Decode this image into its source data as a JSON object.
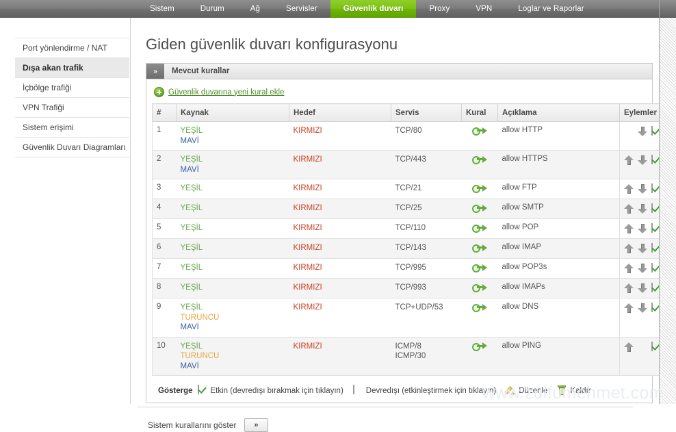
{
  "topnav": {
    "items": [
      {
        "label": "Sistem",
        "active": false
      },
      {
        "label": "Durum",
        "active": false
      },
      {
        "label": "Ağ",
        "active": false
      },
      {
        "label": "Servisler",
        "active": false
      },
      {
        "label": "Güvenlik duvarı",
        "active": true
      },
      {
        "label": "Proxy",
        "active": false
      },
      {
        "label": "VPN",
        "active": false
      },
      {
        "label": "Loglar ve Raporlar",
        "active": false
      }
    ],
    "accent_color": "#7cc114",
    "bar_color": "#7d7d7d"
  },
  "sidebar": {
    "items": [
      {
        "label": "Port yönlendirme / NAT",
        "active": false
      },
      {
        "label": "Dışa akan trafik",
        "active": true
      },
      {
        "label": "İçbölge trafiği",
        "active": false
      },
      {
        "label": "VPN Trafiği",
        "active": false
      },
      {
        "label": "Sistem erişimi",
        "active": false
      },
      {
        "label": "Güvenlik Duvarı Diagramları",
        "active": false
      }
    ]
  },
  "main": {
    "page_title": "Giden güvenlik duvarı konfigurasyonu",
    "panel": {
      "toggle_label": "»",
      "title": "Mevcut kurallar",
      "add_rule_label": "Güvenlik duvarına yeni kural ekle"
    },
    "table": {
      "headers": [
        "#",
        "Kaynak",
        "Hedef",
        "Servis",
        "Kural",
        "Açıklama",
        "Eylemler"
      ],
      "rows": [
        {
          "num": "1",
          "sources": [
            {
              "text": "YEŞİL",
              "color": "green"
            },
            {
              "text": "MAVİ",
              "color": "blue"
            }
          ],
          "dest": "KIRMIZI",
          "service": [
            "TCP/80"
          ],
          "rule_icon": "rule-flow-allow-icon",
          "description": "allow HTTP",
          "actions": [
            "spacer",
            "down",
            "check-on",
            "edit",
            "delete"
          ]
        },
        {
          "num": "2",
          "sources": [
            {
              "text": "YEŞİL",
              "color": "green"
            },
            {
              "text": "MAVİ",
              "color": "blue"
            }
          ],
          "dest": "KIRMIZI",
          "service": [
            "TCP/443"
          ],
          "rule_icon": "rule-flow-allow-icon",
          "description": "allow HTTPS",
          "actions": [
            "up",
            "down",
            "check-on",
            "edit",
            "delete"
          ]
        },
        {
          "num": "3",
          "sources": [
            {
              "text": "YEŞİL",
              "color": "green"
            }
          ],
          "dest": "KIRMIZI",
          "service": [
            "TCP/21"
          ],
          "rule_icon": "rule-flow-allow-icon",
          "description": "allow FTP",
          "actions": [
            "up",
            "down",
            "check-on",
            "edit",
            "delete"
          ]
        },
        {
          "num": "4",
          "sources": [
            {
              "text": "YEŞİL",
              "color": "green"
            }
          ],
          "dest": "KIRMIZI",
          "service": [
            "TCP/25"
          ],
          "rule_icon": "rule-flow-allow-icon",
          "description": "allow SMTP",
          "actions": [
            "up",
            "down",
            "check-on",
            "edit",
            "delete"
          ]
        },
        {
          "num": "5",
          "sources": [
            {
              "text": "YEŞİL",
              "color": "green"
            }
          ],
          "dest": "KIRMIZI",
          "service": [
            "TCP/110"
          ],
          "rule_icon": "rule-flow-allow-icon",
          "description": "allow POP",
          "actions": [
            "up",
            "down",
            "check-on",
            "edit",
            "delete"
          ]
        },
        {
          "num": "6",
          "sources": [
            {
              "text": "YEŞİL",
              "color": "green"
            }
          ],
          "dest": "KIRMIZI",
          "service": [
            "TCP/143"
          ],
          "rule_icon": "rule-flow-allow-icon",
          "description": "allow IMAP",
          "actions": [
            "up",
            "down",
            "check-on",
            "edit",
            "delete"
          ]
        },
        {
          "num": "7",
          "sources": [
            {
              "text": "YEŞİL",
              "color": "green"
            }
          ],
          "dest": "KIRMIZI",
          "service": [
            "TCP/995"
          ],
          "rule_icon": "rule-flow-allow-icon",
          "description": "allow POP3s",
          "actions": [
            "up",
            "down",
            "check-on",
            "edit",
            "delete"
          ]
        },
        {
          "num": "8",
          "sources": [
            {
              "text": "YEŞİL",
              "color": "green"
            }
          ],
          "dest": "KIRMIZI",
          "service": [
            "TCP/993"
          ],
          "rule_icon": "rule-flow-allow-icon",
          "description": "allow IMAPs",
          "actions": [
            "up",
            "down",
            "check-on",
            "edit",
            "delete"
          ]
        },
        {
          "num": "9",
          "sources": [
            {
              "text": "YEŞİL",
              "color": "green"
            },
            {
              "text": "TURUNCU",
              "color": "orange"
            },
            {
              "text": "MAVİ",
              "color": "blue"
            }
          ],
          "dest": "KIRMIZI",
          "service": [
            "TCP+UDP/53"
          ],
          "rule_icon": "rule-flow-allow-icon",
          "description": "allow DNS",
          "actions": [
            "up",
            "down",
            "check-on",
            "edit",
            "delete"
          ]
        },
        {
          "num": "10",
          "sources": [
            {
              "text": "YEŞİL",
              "color": "green"
            },
            {
              "text": "TURUNCU",
              "color": "orange"
            },
            {
              "text": "MAVİ",
              "color": "blue"
            }
          ],
          "dest": "KIRMIZI",
          "service": [
            "ICMP/8",
            "ICMP/30"
          ],
          "rule_icon": "rule-flow-allow-icon",
          "description": "allow PING",
          "actions": [
            "up",
            "spacer",
            "check-on",
            "edit",
            "delete"
          ]
        }
      ]
    },
    "legend": {
      "title": "Gösterge",
      "enabled_label": "Etkin (devredışı bırakmak için tıklayın)",
      "disabled_label": "Devredışı (etkinleştirmek için tıklayın)",
      "edit_label": "Düzenle",
      "delete_label": "Kaldır"
    },
    "footer": {
      "system_rules_label": "Sistem kurallarını göster",
      "system_rules_button": "»"
    }
  },
  "watermark": "www.zulfumehmet.com",
  "zone_colors": {
    "green": "#6aa84f",
    "blue": "#3c5fa8",
    "orange": "#e8a33d",
    "red": "#cc4125"
  }
}
